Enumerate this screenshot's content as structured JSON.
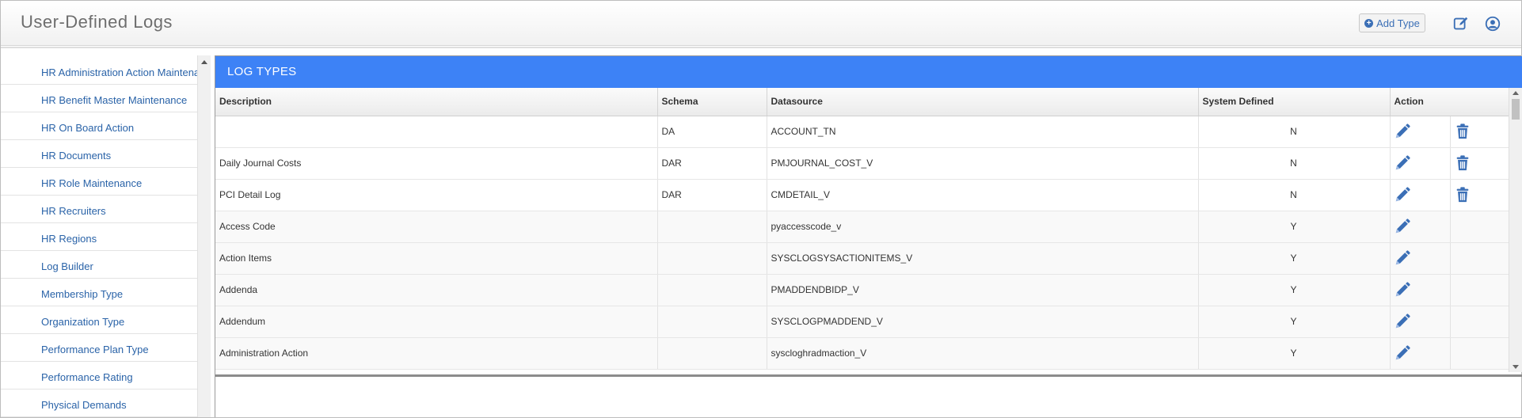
{
  "app": {
    "title": "User-Defined Logs"
  },
  "header": {
    "add_type_label": "Add Type",
    "edit_icon": "edit-icon",
    "user_icon": "user-icon"
  },
  "sidebar": {
    "items": [
      "HR Administration Action Maintenance",
      "HR Benefit Master Maintenance",
      "HR On Board Action",
      "HR Documents",
      "HR Role Maintenance",
      "HR Recruiters",
      "HR Regions",
      "Log Builder",
      "Membership Type",
      "Organization Type",
      "Performance Plan Type",
      "Performance Rating",
      "Physical Demands"
    ]
  },
  "panel": {
    "title": "LOG TYPES",
    "columns": [
      "Description",
      "Schema",
      "Datasource",
      "System Defined",
      "Action"
    ],
    "rows": [
      {
        "description": "",
        "schema": "DA",
        "datasource": "ACCOUNT_TN",
        "system_defined": "N",
        "deletable": true
      },
      {
        "description": "Daily Journal Costs",
        "schema": "DAR",
        "datasource": "PMJOURNAL_COST_V",
        "system_defined": "N",
        "deletable": true
      },
      {
        "description": "PCI Detail Log",
        "schema": "DAR",
        "datasource": "CMDETAIL_V",
        "system_defined": "N",
        "deletable": true
      },
      {
        "description": "Access Code",
        "schema": "",
        "datasource": "pyaccesscode_v",
        "system_defined": "Y",
        "deletable": false
      },
      {
        "description": "Action Items",
        "schema": "",
        "datasource": "SYSCLOGSYSACTIONITEMS_V",
        "system_defined": "Y",
        "deletable": false
      },
      {
        "description": "Addenda",
        "schema": "",
        "datasource": "PMADDENDBIDP_V",
        "system_defined": "Y",
        "deletable": false
      },
      {
        "description": "Addendum",
        "schema": "",
        "datasource": "SYSCLOGPMADDEND_V",
        "system_defined": "Y",
        "deletable": false
      },
      {
        "description": "Administration Action",
        "schema": "",
        "datasource": "syscloghradmaction_V",
        "system_defined": "Y",
        "deletable": false
      }
    ]
  },
  "colors": {
    "accent": "#3d82f6",
    "link": "#2a63a8",
    "icon": "#3b6fb6"
  }
}
